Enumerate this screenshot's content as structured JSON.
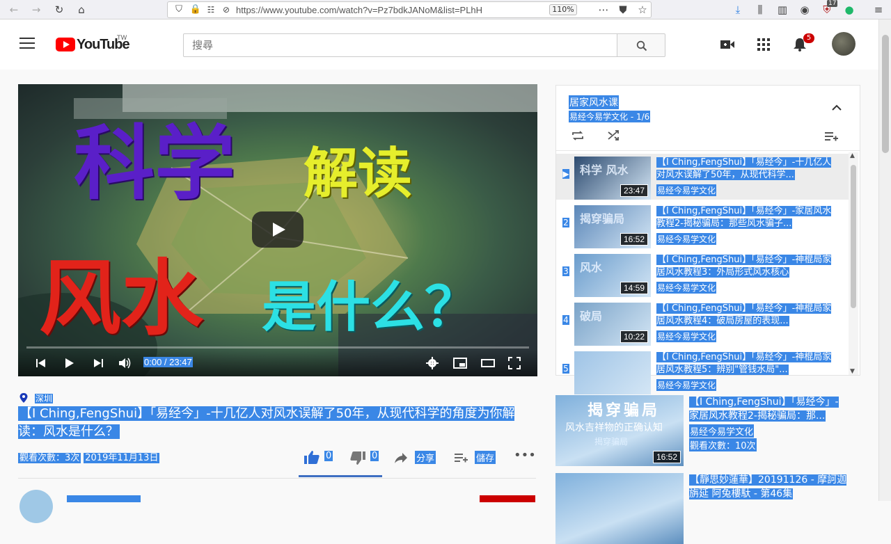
{
  "browser": {
    "url": "https://www.youtube.com/watch?v=Pz7bdkJANoM&list=PLhH",
    "zoom": "110%",
    "ext_badge": "17"
  },
  "header": {
    "logo_text": "YouTube",
    "logo_region": "TW",
    "search_placeholder": "搜尋",
    "notifications_count": "5"
  },
  "player": {
    "thumb_text": {
      "line1": "科学",
      "line1b": "解读",
      "line2": "风水",
      "line2b": "是什么？"
    },
    "time": "0:00 / 23:47",
    "progress": 0
  },
  "video": {
    "location": "深圳",
    "title": "【I Ching,FengShui】「易经今」-十几亿人对风水误解了50年，从现代科学的角度为你解读：风水是什么？",
    "views": "觀看次數：3次",
    "date": "2019年11月13日",
    "likes": "0",
    "dislikes": "0",
    "share_label": "分享",
    "save_label": "儲存"
  },
  "playlist": {
    "title": "居家风水课",
    "subtitle": "易经今易学文化 - 1/6",
    "items": [
      {
        "index": "▶",
        "title": "【I Ching,FengShui】「易经今」-十几亿人对风水误解了50年，从现代科学...",
        "channel": "易经今易学文化",
        "duration": "23:47",
        "thumb": "科学 风水",
        "active": true
      },
      {
        "index": "2",
        "title": "【I Ching,FengShui】「易经今」-家居风水教程2-揭秘骗局：那些风水骗子...",
        "channel": "易经今易学文化",
        "duration": "16:52",
        "thumb": "揭穿骗局"
      },
      {
        "index": "3",
        "title": "【I Ching,FengShui】「易经今」-神棍局家居风水教程3：外局形式风水核心",
        "channel": "易经今易学文化",
        "duration": "14:59",
        "thumb": "风水"
      },
      {
        "index": "4",
        "title": "【I Ching,FengShui】「易经今」-神棍局家居风水教程4：破局房屋的表现...",
        "channel": "易经今易学文化",
        "duration": "10:22",
        "thumb": "破局"
      },
      {
        "index": "5",
        "title": "【I Ching,FengShui】「易经今」-神棍局家居风水教程5：辨别\"管钱水局\"...",
        "channel": "易经今易学文化",
        "duration": "",
        "thumb": ""
      }
    ]
  },
  "recommended": [
    {
      "title": "【I Ching,FengShui】「易经今」-家居风水教程2-揭秘骗局：那...",
      "channel": "易经今易学文化",
      "views": "觀看次數：10次",
      "duration": "16:52",
      "thumb_top": "揭穿骗局",
      "thumb_mid": "风水吉祥物的正确认知",
      "thumb_bot": "揭穿骗局"
    },
    {
      "title": "【靜思妙蓮華】20191126 - 摩訶迦旃延 阿兔樓馱 - 第46集",
      "channel": "",
      "views": "",
      "duration": "",
      "thumb_top": "",
      "thumb_mid": "",
      "thumb_bot": ""
    }
  ],
  "colors": {
    "highlight": "#3a87e6",
    "youtube_red": "#ff0000"
  }
}
